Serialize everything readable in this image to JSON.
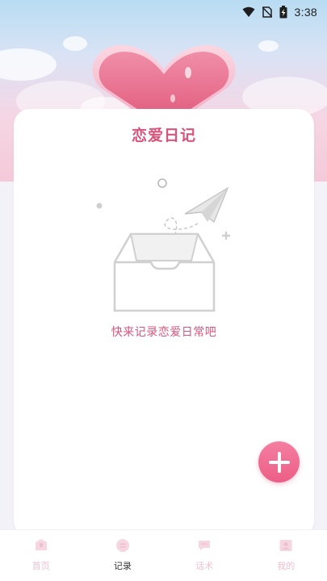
{
  "status_bar": {
    "time": "3:38"
  },
  "page": {
    "title": "恋爱日记"
  },
  "empty_state": {
    "message": "快来记录恋爱日常吧"
  },
  "fab": {
    "icon": "plus-icon"
  },
  "bottom_nav": {
    "items": [
      {
        "label": "首页",
        "icon": "home-icon",
        "active": false
      },
      {
        "label": "记录",
        "icon": "record-icon",
        "active": true
      },
      {
        "label": "话术",
        "icon": "chat-icon",
        "active": false
      },
      {
        "label": "我的",
        "icon": "profile-icon",
        "active": false
      }
    ]
  },
  "colors": {
    "accent": "#d8547d",
    "fab": "#ec5e86",
    "inactive_nav": "#ecc1cf",
    "card": "#ffffff",
    "page_bg": "#f3f2f8"
  }
}
